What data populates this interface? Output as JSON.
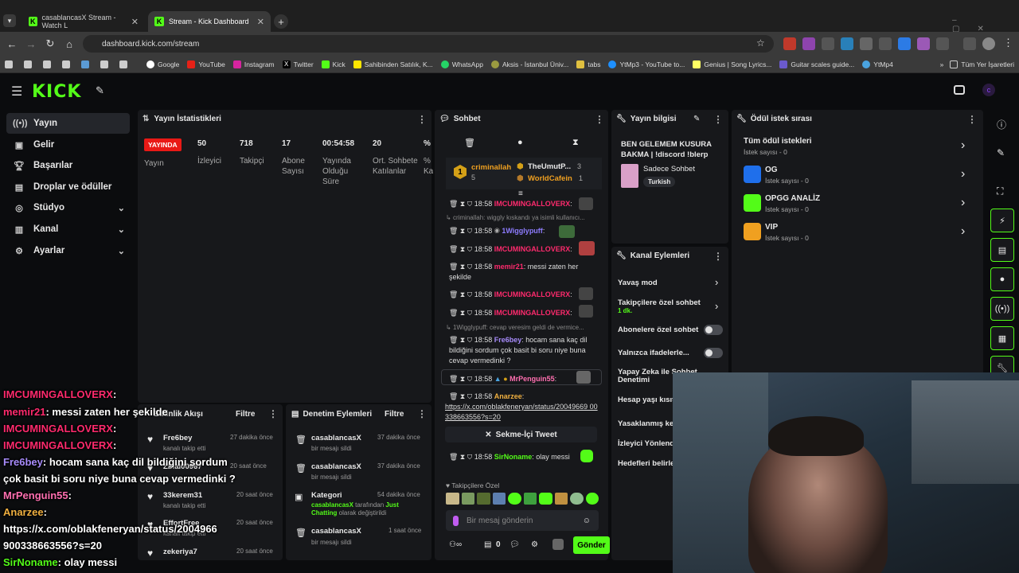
{
  "browser": {
    "tabs": [
      {
        "title": "casablancasX Stream - Watch L"
      },
      {
        "title": "Stream - Kick Dashboard"
      }
    ],
    "url": "dashboard.kick.com/stream",
    "bookmarks": [
      "Google",
      "YouTube",
      "Instagram",
      "Twitter",
      "Kick",
      "Sahibinden Satılık, K...",
      "WhatsApp",
      "Aksis - İstanbul Üniv...",
      "tabs",
      "YtMp3 - YouTube to...",
      "Genius | Song Lyrics...",
      "Guitar scales guide...",
      "YtMp4"
    ],
    "all_bookmarks": "Tüm Yer İşaretleri"
  },
  "sidebar": {
    "items": [
      {
        "label": "Yayın"
      },
      {
        "label": "Gelir"
      },
      {
        "label": "Başarılar"
      },
      {
        "label": "Droplar ve ödüller"
      },
      {
        "label": "Stüdyo"
      },
      {
        "label": "Kanal"
      },
      {
        "label": "Ayarlar"
      }
    ]
  },
  "stats": {
    "title": "Yayın İstatistikleri",
    "live_badge": "YAYINDA",
    "live_label": "Yayın",
    "cols": [
      {
        "value": "50",
        "label": "İzleyici"
      },
      {
        "value": "718",
        "label": "Takipçi"
      },
      {
        "value": "17",
        "label": "Abone Sayısı"
      },
      {
        "value": "00:54:58",
        "label": "Yayında Olduğu Süre"
      },
      {
        "value": "20",
        "label": "Ort. Sohbete Katılanlar"
      },
      {
        "value": "%",
        "label": "% Ka"
      }
    ]
  },
  "activity": {
    "title": "Etkinlik Akışı",
    "filter": "Filtre",
    "items": [
      {
        "user": "Fre6bey",
        "sub": "kanalı takip etti",
        "time": "27 dakika önce"
      },
      {
        "user": "Zblal00967",
        "sub": "",
        "time": "20 saat önce"
      },
      {
        "user": "33kerem31",
        "sub": "kanalı takip etti",
        "time": "20 saat önce"
      },
      {
        "user": "EffortFree",
        "sub": "kanalı takip etti",
        "time": "20 saat önce"
      },
      {
        "user": "zekeriya7",
        "sub": "",
        "time": "20 saat önce"
      }
    ]
  },
  "moderation": {
    "title": "Denetim Eylemleri",
    "filter": "Filtre",
    "items": [
      {
        "user": "casablancasX",
        "sub": "bir mesajı sildi",
        "time": "37 dakika önce"
      },
      {
        "user": "casablancasX",
        "sub": "bir mesajı sildi",
        "time": "37 dakika önce"
      },
      {
        "user": "Kategori",
        "sub_user": "casablancasX",
        "sub_mid": " tarafından ",
        "sub_cat": "Just Chatting",
        "sub_end": " olarak değiştirildi",
        "time": "54 dakika önce"
      },
      {
        "user": "casablancasX",
        "sub": "bir mesajı sildi",
        "time": "1 saat önce"
      }
    ]
  },
  "chat": {
    "title": "Sohbet",
    "top_gifters": [
      {
        "rank": "1",
        "name": "criminallah",
        "count": "5"
      },
      {
        "name": "TheUmutP...",
        "count": "3"
      },
      {
        "name": "WorldCafein",
        "count": "1"
      }
    ],
    "messages": [
      {
        "time": "18:58",
        "user": "IMCUMINGALLOVERX",
        "text": ":"
      },
      {
        "reply": "criminallah: wiggly kıskandı ya isimli kullanıcı..."
      },
      {
        "time": "18:58",
        "user": "1Wigglypuff",
        "text": ":"
      },
      {
        "time": "18:58",
        "user": "IMCUMINGALLOVERX",
        "text": ":"
      },
      {
        "time": "18:58",
        "user": "memir21",
        "text": ": messi zaten her şekilde"
      },
      {
        "time": "18:58",
        "user": "IMCUMINGALLOVERX",
        "text": ":"
      },
      {
        "time": "18:58",
        "user": "IMCUMINGALLOVERX",
        "text": ":"
      },
      {
        "reply": "1Wigglypuff: cevap veresim geldi de vermice..."
      },
      {
        "time": "18:58",
        "user": "Fre6bey",
        "text": ": hocam sana kaç dil bildiğini sordum çok basit bi soru niye buna cevap vermedinki ?"
      },
      {
        "time": "18:58",
        "user": "MrPenguin55",
        "text": ":"
      },
      {
        "time": "18:58",
        "user": "Anarzee",
        "text": ":"
      },
      {
        "link": "https://x.com/oblakfeneryan/status/20049669 00338663556?s=20"
      },
      {
        "tweet": "Sekme-İçi Tweet"
      },
      {
        "time": "18:58",
        "user": "SirNoname",
        "text": ": olay messi"
      }
    ],
    "emote_label": "Takipçilere Özel",
    "input_placeholder": "Bir mesaj gönderin",
    "footer_count": "0",
    "send": "Gönder"
  },
  "stream_info": {
    "title": "Yayın bilgisi",
    "stream_title": "BEN GELEMEM KUSURA BAKMA | !discord !blerp",
    "category": "Sadece Sohbet",
    "tag": "Turkish"
  },
  "channel_actions": {
    "title": "Kanal Eylemleri",
    "items": [
      {
        "label": "Yavaş mod",
        "type": "chevron"
      },
      {
        "label": "Takipçilere özel sohbet",
        "sub": "1 dk.",
        "type": "chevron"
      },
      {
        "label": "Abonelere özel sohbet",
        "type": "toggle"
      },
      {
        "label": "Yalnızca ifadelerle...",
        "type": "toggle"
      },
      {
        "label": "Yapay Zeka ile Sohbet Denetimi",
        "type": "ext"
      },
      {
        "label": "Hesap yaşı kısıt",
        "type": "none"
      },
      {
        "label": "Yasaklanmış ke",
        "type": "none"
      },
      {
        "label": "İzleyici Yönlend",
        "type": "none"
      },
      {
        "label": "Hedefleri belirle",
        "type": "none"
      }
    ]
  },
  "rewards": {
    "title": "Ödül istek sırası",
    "items": [
      {
        "label": "Tüm ödül istekleri",
        "sub": "İstek sayısı - 0",
        "color": ""
      },
      {
        "label": "OG",
        "sub": "İstek sayısı - 0",
        "color": "#1f6feb"
      },
      {
        "label": "OPGG ANALİZ",
        "sub": "İstek sayısı - 0",
        "color": "#53fc18"
      },
      {
        "label": "VIP",
        "sub": "İstek sayısı - 0",
        "color": "#f0a020"
      }
    ]
  },
  "overlay_chat": [
    {
      "user": "IMCUMINGALLOVERX",
      "text": ":",
      "color": "#ff2a6d"
    },
    {
      "user": "memir21",
      "text": ":  messi zaten her şekilde",
      "color": "#ff2a6d"
    },
    {
      "user": "IMCUMINGALLOVERX",
      "text": ":",
      "color": "#ff2a6d"
    },
    {
      "user": "IMCUMINGALLOVERX",
      "text": ":",
      "color": "#ff2a6d"
    },
    {
      "user": "Fre6bey",
      "text": ":  hocam sana kaç dil bildiğini sordum",
      "color": "#a78bfa"
    },
    {
      "user": "",
      "text": "çok basit bi soru niye buna cevap vermedinki ?",
      "color": "#fff"
    },
    {
      "user": "MrPenguin55",
      "text": ":",
      "color": "#ff6fb0"
    },
    {
      "user": "Anarzee",
      "text": ":",
      "color": "#f0b040"
    },
    {
      "user": "",
      "text": "https://x.com/oblakfeneryan/status/2004966",
      "color": "#fff"
    },
    {
      "user": "",
      "text": "900338663556?s=20",
      "color": "#fff"
    },
    {
      "user": "SirNoname",
      "text": ":  olay messi",
      "color": "#53fc18"
    }
  ],
  "colors": {
    "brand": "#53fc18",
    "live": "#e91916",
    "panel": "#17181b",
    "highlight": "#ff2a6d"
  }
}
